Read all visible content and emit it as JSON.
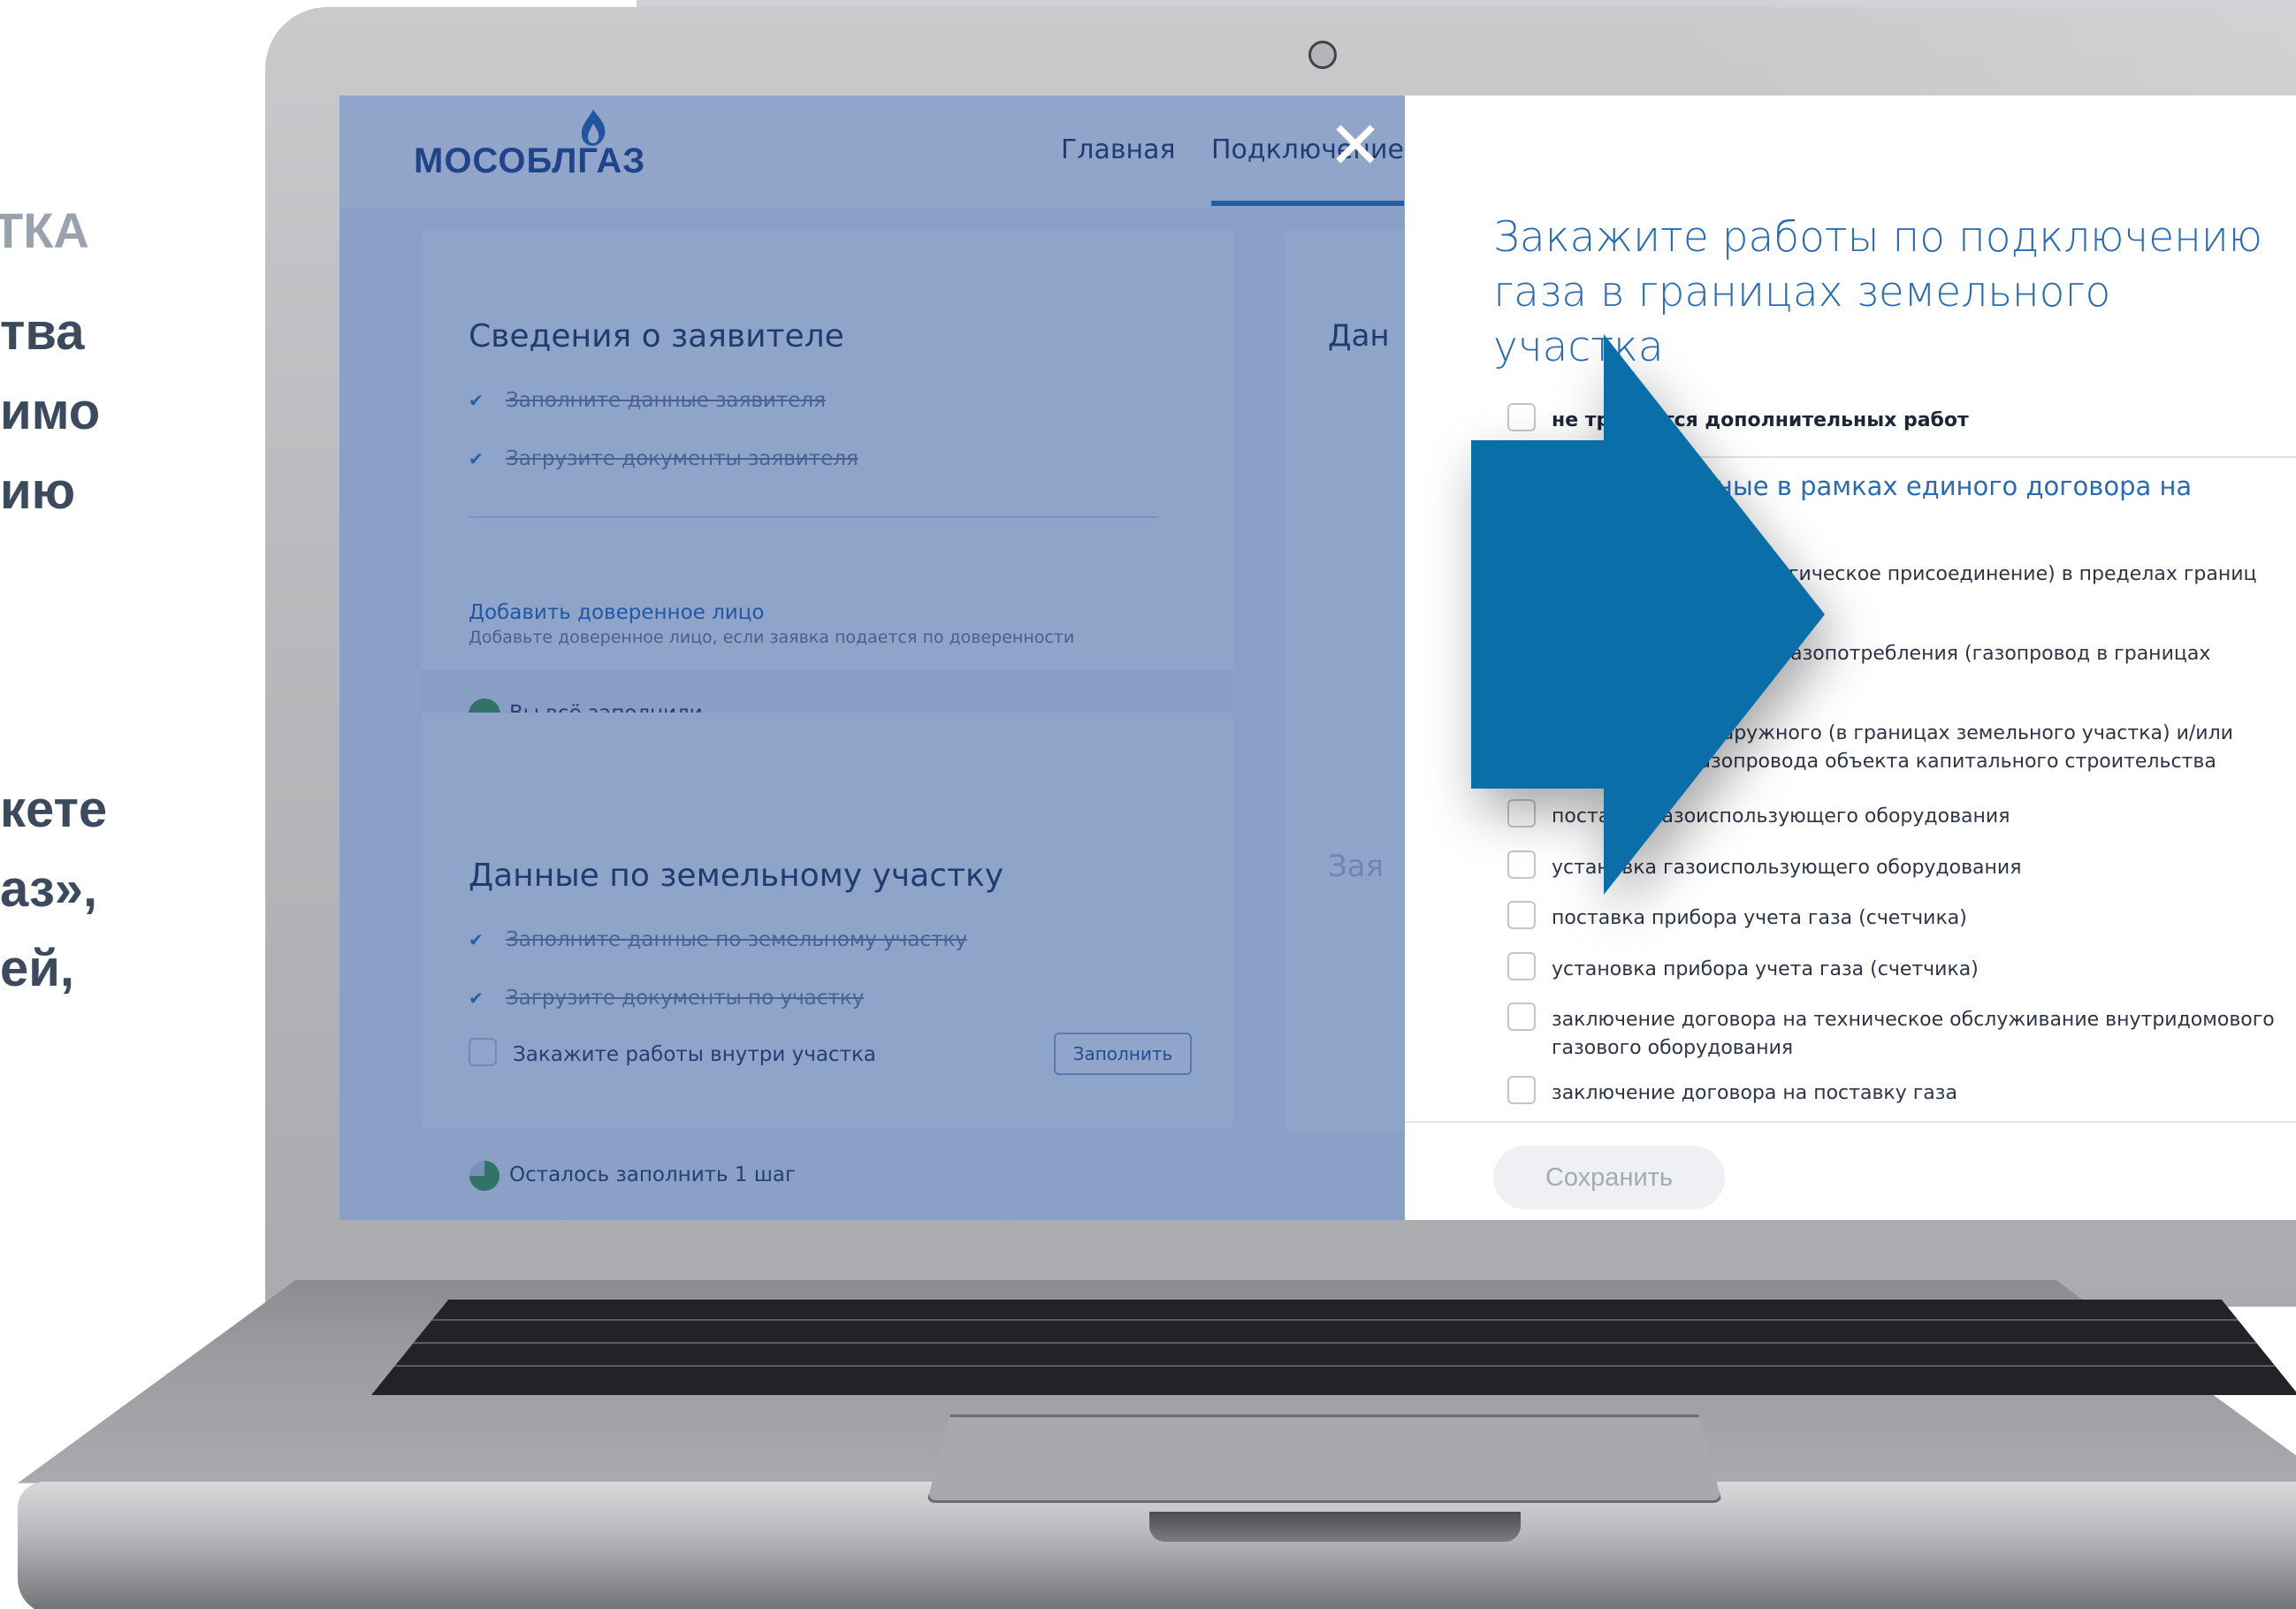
{
  "slide": {
    "eyebrow": "ТКА",
    "lines_top": [
      "тва",
      "имо",
      "ию"
    ],
    "lines_bottom": [
      "кете",
      "аз»,",
      "ей,"
    ]
  },
  "app": {
    "logo": "МОСОБЛГАЗ",
    "nav": {
      "main": "Главная",
      "connect": "Подключение"
    },
    "applicant_card": {
      "title": "Сведения о заявителе",
      "tasks": [
        "Заполните данные заявителя",
        "Загрузите документы заявителя"
      ],
      "add_proxy": "Добавить доверенное лицо",
      "add_proxy_hint": "Добавьте доверенное лицо, если заявка подается по доверенности",
      "status": "Вы всё заполнили"
    },
    "land_card": {
      "title": "Данные по земельному участку",
      "tasks": [
        "Заполните данные по земельному участку",
        "Загрузите документы по участку"
      ],
      "order_task": "Закажите работы внутри участка",
      "fill_button": "Заполнить",
      "status": "Осталось заполнить 1 шаг"
    },
    "right_card": {
      "title_partial": "Дан",
      "lower_partial": "Зая"
    }
  },
  "modal": {
    "title": "Закажите работы по подключению газа в границах земельного участка",
    "no_extra": "не требуется дополнительных работ",
    "section_heading": "Работы, доступные в рамках единого договора на догазификацию:",
    "options": [
      "подключение (технологическое присоединение) в пределах границ земельного участка",
      "проектирование сети газопотребления (газопровод в границах земельного участка)",
      "строительство наружного (в границах земельного участка) и/или внутреннего газопровода объекта капитального строительства",
      "поставка газоиспользующего оборудования",
      "установка газоиспользующего оборудования",
      "поставка прибора учета газа (счетчика)",
      "установка прибора учета газа (счетчика)",
      "заключение договора на техническое обслуживание внутридомового газового оборудования",
      "заключение договора на поставку газа"
    ],
    "save_button": "Сохранить"
  },
  "icons": {
    "check": "check-icon",
    "close": "close-icon",
    "arrow": "arrow-right-icon",
    "camera": "camera-icon",
    "flame": "flame-icon"
  },
  "colors": {
    "brand_blue": "#1f72b8",
    "arrow_blue": "#0a6ea8",
    "modal_title": "#2a6cb3",
    "status_done": "#3f9a3a"
  }
}
